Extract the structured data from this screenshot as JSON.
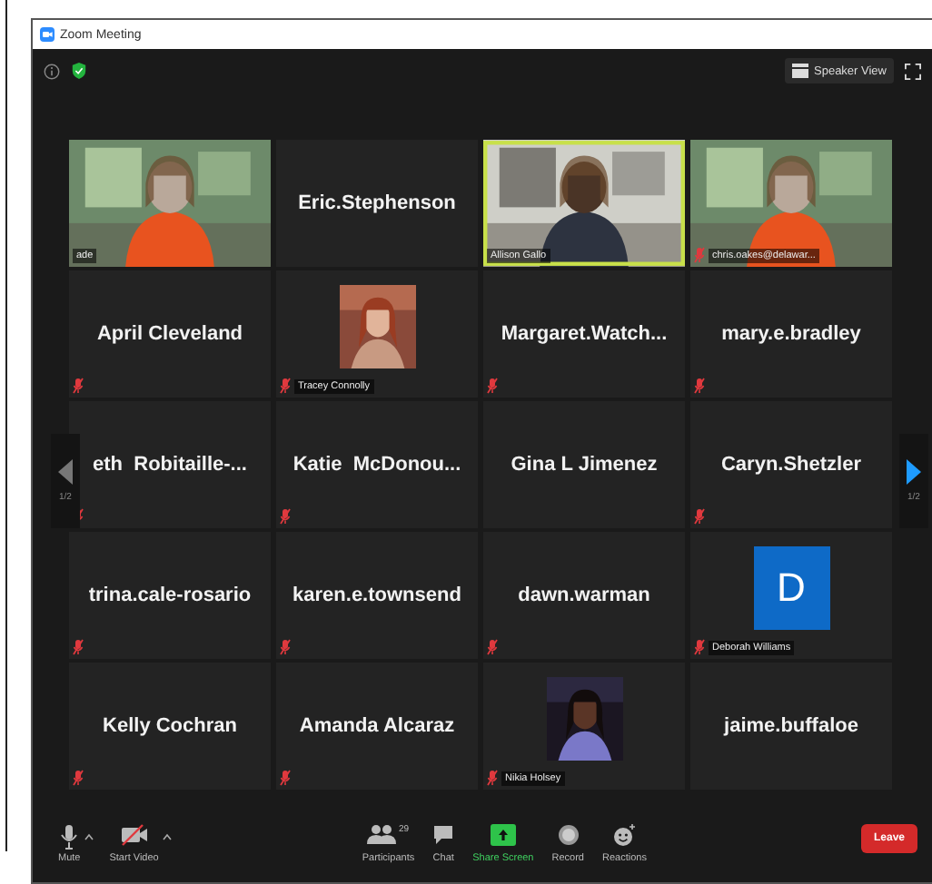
{
  "window": {
    "title": "Zoom Meeting"
  },
  "top_bar": {
    "view_button": "Speaker View"
  },
  "pager": {
    "left": {
      "label": "1/2",
      "disabled": true
    },
    "right": {
      "label": "1/2",
      "disabled": false
    }
  },
  "tiles": [
    {
      "kind": "video",
      "name": "ade",
      "muted": false,
      "speaking": false
    },
    {
      "kind": "name",
      "name": "Eric.Stephenson",
      "muted": false,
      "speaking": false
    },
    {
      "kind": "video",
      "name": "Allison Gallo",
      "muted": false,
      "speaking": true
    },
    {
      "kind": "video",
      "name": "chris.oakes@delawar...",
      "muted": true,
      "speaking": false
    },
    {
      "kind": "name",
      "name": "April Cleveland",
      "muted": true,
      "speaking": false
    },
    {
      "name": "Tracey Connolly",
      "muted": true,
      "speaking": false
    },
    {
      "kind": "name",
      "name": "Margaret.Watch...",
      "muted": true,
      "speaking": false
    },
    {
      "kind": "name",
      "name": "mary.e.bradley",
      "muted": true,
      "speaking": false
    },
    {
      "kind": "name",
      "name": "eth  Robitaille-...",
      "muted": true,
      "speaking": false
    },
    {
      "kind": "name",
      "name": "Katie  McDonou...",
      "muted": true,
      "speaking": false
    },
    {
      "kind": "name",
      "name": "Gina L Jimenez",
      "muted": false,
      "speaking": false
    },
    {
      "kind": "name",
      "name": "Caryn.Shetzler",
      "muted": true,
      "speaking": false
    },
    {
      "kind": "name",
      "name": "trina.cale-rosario",
      "muted": true,
      "speaking": false
    },
    {
      "kind": "name",
      "name": "karen.e.townsend",
      "muted": true,
      "speaking": false
    },
    {
      "kind": "name",
      "name": "dawn.warman",
      "muted": true,
      "speaking": false
    },
    {
      "kind": "avatar",
      "initial": "D",
      "name": "Deborah Williams",
      "muted": true,
      "speaking": false
    },
    {
      "kind": "name",
      "name": "Kelly Cochran",
      "muted": true,
      "speaking": false
    },
    {
      "kind": "name",
      "name": "Amanda Alcaraz",
      "muted": true,
      "speaking": false
    },
    {
      "name": "Nikia Holsey",
      "muted": true,
      "speaking": false
    },
    {
      "kind": "name",
      "name": "jaime.buffaloe",
      "muted": false,
      "speaking": false
    }
  ],
  "toolbar": {
    "items": [
      {
        "kind": "mic",
        "label": "Mute",
        "caret": true
      },
      {
        "kind": "video",
        "label": "Start Video",
        "caret": true
      },
      {
        "kind": "participants",
        "label": "Participants",
        "count": "29",
        "caret": false
      },
      {
        "kind": "chat",
        "label": "Chat",
        "caret": false
      },
      {
        "kind": "share",
        "label": "Share Screen",
        "caret": false
      },
      {
        "kind": "record",
        "label": "Record",
        "caret": false
      },
      {
        "kind": "reactions",
        "label": "Reactions",
        "caret": false
      }
    ],
    "leave": "Leave"
  }
}
